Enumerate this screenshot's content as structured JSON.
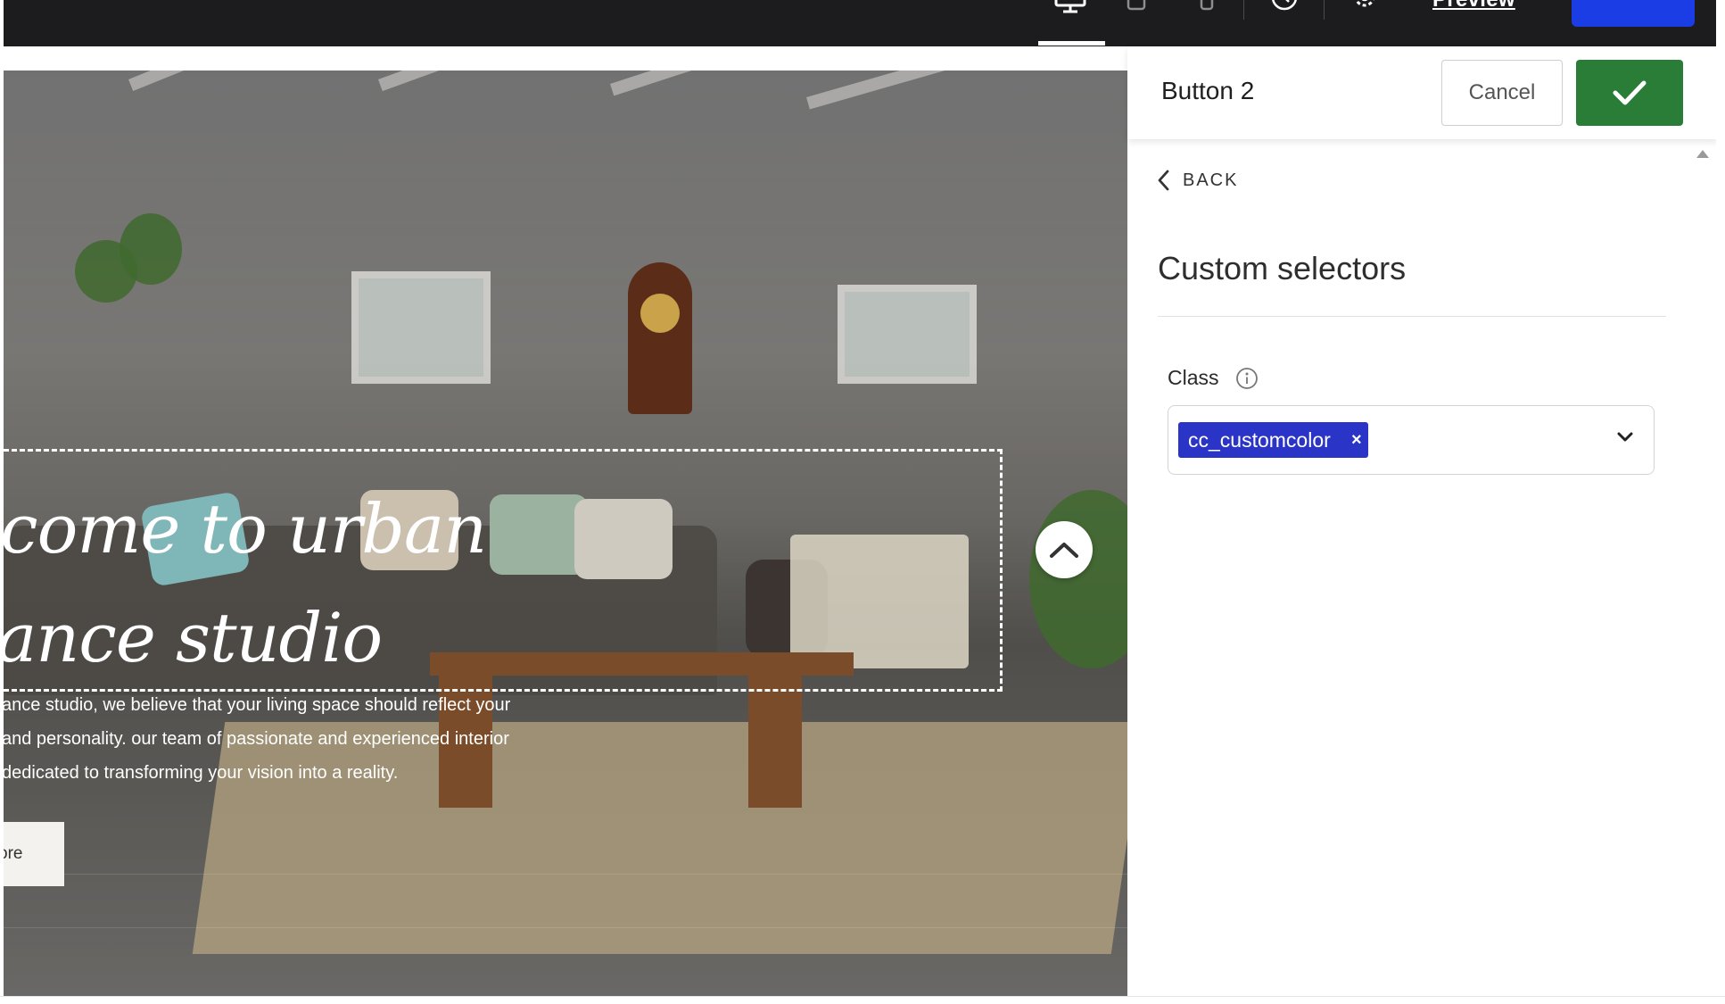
{
  "toolbar": {
    "icons": [
      "desktop-icon",
      "tablet-icon",
      "mobile-icon",
      "history-icon",
      "settings-icon"
    ],
    "active_device": "desktop",
    "preview_label": "Preview"
  },
  "canvas": {
    "hero": {
      "title_line1": "come to urban",
      "title_line2": "ance studio",
      "description": [
        "ance studio, we believe that your living space should reflect your",
        "and personality. our team of passionate and experienced interior",
        "dedicated to transforming your vision into a reality."
      ],
      "button_label": "ore"
    }
  },
  "panel": {
    "title": "Button 2",
    "cancel_label": "Cancel",
    "back_label": "BACK",
    "section_title": "Custom selectors",
    "class_label": "Class",
    "class_tags": [
      "cc_customcolor"
    ],
    "tag_remove_symbol": "×"
  },
  "colors": {
    "toolbar_bg": "#1c1c1e",
    "publish_blue": "#1a3de6",
    "confirm_green": "#2a7d37",
    "tag_blue": "#2a35c8"
  }
}
